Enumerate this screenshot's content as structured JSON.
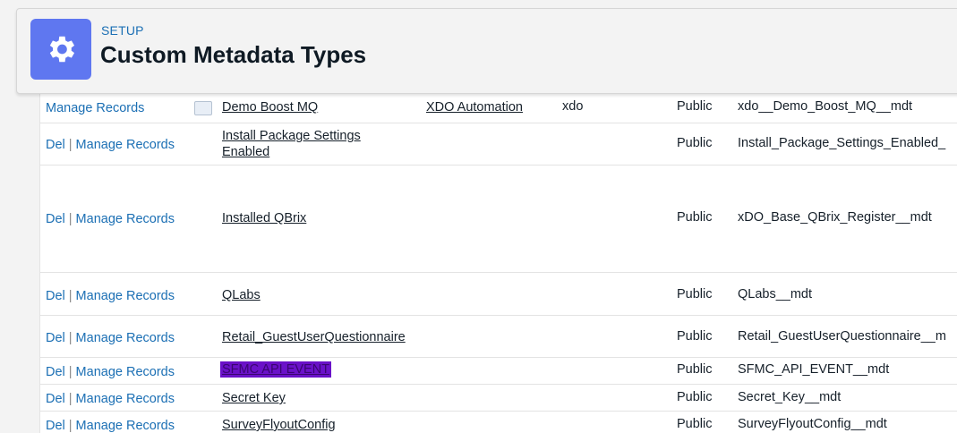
{
  "header": {
    "setup_label": "SETUP",
    "title": "Custom Metadata Types",
    "icon": "gear-icon",
    "icon_bg": "#5f77f0"
  },
  "clipped_row": {
    "action": "Manage Records",
    "label": "Demo Boost MQ",
    "package": "XDO Automation",
    "namespace": "xdo",
    "visibility": "Public",
    "api_name": "xdo__Demo_Boost_MQ__mdt"
  },
  "actions": {
    "del": "Del",
    "separator": "|",
    "manage": "Manage Records"
  },
  "rows": [
    {
      "label": "Install Package Settings Enabled",
      "visibility": "Public",
      "api_name": "Install_Package_Settings_Enabled_"
    },
    {
      "label": "Installed QBrix",
      "visibility": "Public",
      "api_name": "xDO_Base_QBrix_Register__mdt"
    },
    {
      "label": "QLabs",
      "visibility": "Public",
      "api_name": "QLabs__mdt"
    },
    {
      "label": "Retail_GuestUserQuestionnaire",
      "visibility": "Public",
      "api_name": "Retail_GuestUserQuestionnaire__m"
    },
    {
      "label": "SFMC API EVENT",
      "visibility": "Public",
      "api_name": "SFMC_API_EVENT__mdt"
    },
    {
      "label": "Secret Key",
      "visibility": "Public",
      "api_name": "Secret_Key__mdt"
    },
    {
      "label": "SurveyFlyoutConfig",
      "visibility": "Public",
      "api_name": "SurveyFlyoutConfig__mdt"
    }
  ]
}
